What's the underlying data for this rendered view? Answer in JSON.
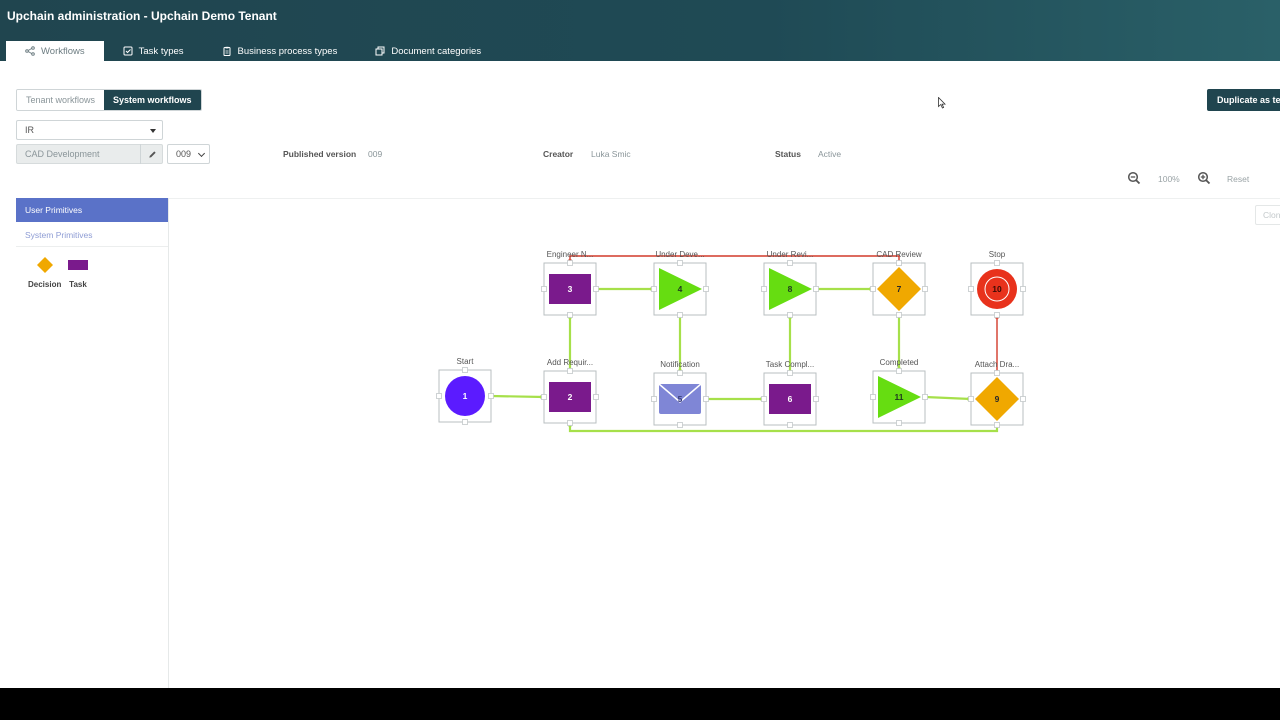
{
  "app": {
    "title": "Upchain administration - Upchain Demo Tenant"
  },
  "tabs": [
    {
      "label": "Workflows",
      "icon": "workflow-icon",
      "active": true
    },
    {
      "label": "Task types",
      "icon": "checkbox-icon"
    },
    {
      "label": "Business process types",
      "icon": "clipboard-icon"
    },
    {
      "label": "Document categories",
      "icon": "documents-icon"
    }
  ],
  "toggle": {
    "tenant": "Tenant workflows",
    "system": "System workflows",
    "selected": "System workflows"
  },
  "duplicate_button": "Duplicate as te",
  "workflow_select": {
    "value": "IR"
  },
  "workflow_name": {
    "value": "CAD Development"
  },
  "version_select": {
    "value": "009"
  },
  "meta": {
    "published_label": "Published version",
    "published_value": "009",
    "creator_label": "Creator",
    "creator_value": "Luka Smic",
    "status_label": "Status",
    "status_value": "Active"
  },
  "zoom": {
    "level": "100%",
    "reset": "Reset"
  },
  "primitives": {
    "user_tab": "User Primitives",
    "system_tab": "System Primitives",
    "items": [
      {
        "label": "Decision",
        "icon": "diamond"
      },
      {
        "label": "Task",
        "icon": "rectangle"
      }
    ]
  },
  "clone_button": "Clon",
  "colors": {
    "header": "#20454f",
    "accent": "#5a72c8",
    "task": "#7a1a8c",
    "decision": "#f0a800",
    "review": "#66dd11",
    "start": "#5b1bff",
    "stop": "#e8321c",
    "link_ok": "#a6e04a",
    "link_reject": "#d23a2a"
  },
  "diagram": {
    "nodes": [
      {
        "id": "1",
        "type": "start",
        "label": "Start"
      },
      {
        "id": "2",
        "type": "task",
        "label": "Add Requir..."
      },
      {
        "id": "3",
        "type": "task",
        "label": "Engineer N..."
      },
      {
        "id": "4",
        "type": "review",
        "label": "Under Deve..."
      },
      {
        "id": "5",
        "type": "notification",
        "label": "Notification"
      },
      {
        "id": "6",
        "type": "task",
        "label": "Task Compl..."
      },
      {
        "id": "7",
        "type": "decision",
        "label": "CAD Review"
      },
      {
        "id": "8",
        "type": "review",
        "label": "Under Revi..."
      },
      {
        "id": "9",
        "type": "decision",
        "label": "Attach Dra..."
      },
      {
        "id": "10",
        "type": "stop",
        "label": "Stop"
      },
      {
        "id": "11",
        "type": "review",
        "label": "Completed"
      }
    ],
    "links": [
      {
        "from": "1",
        "to": "2",
        "kind": "ok"
      },
      {
        "from": "2",
        "to": "3",
        "kind": "ok"
      },
      {
        "from": "3",
        "to": "4",
        "kind": "ok"
      },
      {
        "from": "4",
        "to": "5",
        "kind": "ok"
      },
      {
        "from": "5",
        "to": "6",
        "kind": "ok"
      },
      {
        "from": "6",
        "to": "8",
        "kind": "ok"
      },
      {
        "from": "8",
        "to": "7",
        "kind": "ok"
      },
      {
        "from": "7",
        "to": "11",
        "kind": "ok"
      },
      {
        "from": "11",
        "to": "9",
        "kind": "ok"
      },
      {
        "from": "9",
        "to": "2",
        "kind": "ok"
      },
      {
        "from": "9",
        "to": "10",
        "kind": "reject"
      },
      {
        "from": "7",
        "to": "3",
        "kind": "reject"
      }
    ]
  }
}
